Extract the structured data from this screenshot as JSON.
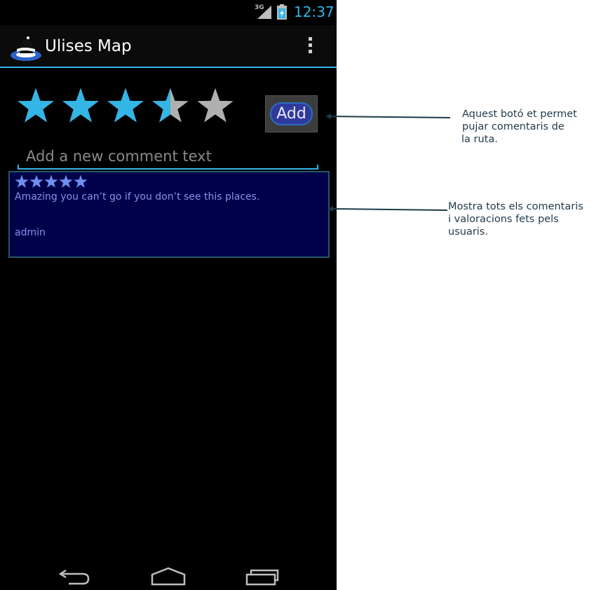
{
  "status_bar": {
    "network": "3G",
    "time": "12:37",
    "accent": "#33b5e5"
  },
  "action_bar": {
    "title": "Ulises Map",
    "icon": "app-logo-icon",
    "overflow_icon": "overflow-menu-icon"
  },
  "rating": {
    "value": 3.5,
    "max": 5,
    "filled_color": "#33b5e5",
    "empty_color": "#b0b0b0"
  },
  "add_button": {
    "label": "Add"
  },
  "comment_input": {
    "value": "",
    "placeholder": "Add a new comment text"
  },
  "comments": [
    {
      "rating": 5,
      "text": "Amazing you can’t go if you don’t see this places.",
      "author": "admin"
    }
  ],
  "nav_bar": {
    "icons": [
      "back-icon",
      "home-icon",
      "recent-apps-icon"
    ]
  },
  "annotations": [
    {
      "lines": [
        "Aquest botó et permet",
        "pujar comentaris de",
        "la ruta."
      ]
    },
    {
      "lines": [
        "Mostra tots els comentaris",
        "i valoracions fets pels",
        "usuaris."
      ]
    }
  ]
}
